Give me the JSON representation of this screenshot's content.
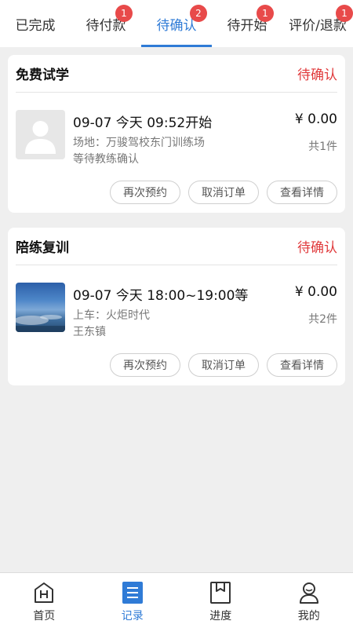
{
  "tabs": [
    {
      "label": "已完成",
      "badge": "",
      "active": false
    },
    {
      "label": "待付款",
      "badge": "1",
      "active": false
    },
    {
      "label": "待确认",
      "badge": "2",
      "active": true
    },
    {
      "label": "待开始",
      "badge": "1",
      "active": false
    },
    {
      "label": "评价/退款",
      "badge": "1",
      "active": false
    }
  ],
  "orders": [
    {
      "title": "免费试学",
      "status": "待确认",
      "thumb_icon": "avatar-placeholder-icon",
      "time": "09-07 今天  09:52开始",
      "line1": "场地：万骏驾校东门训练场",
      "line2": "等待教练确认",
      "price": "¥ 0.00",
      "count": "共1件",
      "buttons": {
        "rebook": "再次预约",
        "cancel": "取消订单",
        "detail": "查看详情"
      }
    },
    {
      "title": "陪练复训",
      "status": "待确认",
      "thumb_icon": "sky-photo",
      "time": "09-07 今天  18:00~19:00等",
      "line1": "上车：火炬时代",
      "line2": "王东镇",
      "price": "¥ 0.00",
      "count": "共2件",
      "buttons": {
        "rebook": "再次预约",
        "cancel": "取消订单",
        "detail": "查看详情"
      }
    }
  ],
  "bottom_nav": [
    {
      "label": "首页",
      "icon": "home-icon",
      "active": false
    },
    {
      "label": "记录",
      "icon": "records-icon",
      "active": true
    },
    {
      "label": "进度",
      "icon": "progress-icon",
      "active": false
    },
    {
      "label": "我的",
      "icon": "profile-icon",
      "active": false
    }
  ],
  "colors": {
    "accent": "#2f7bd6",
    "status_red": "#e0393b",
    "badge_red": "#e84a4a",
    "background": "#efefef"
  }
}
